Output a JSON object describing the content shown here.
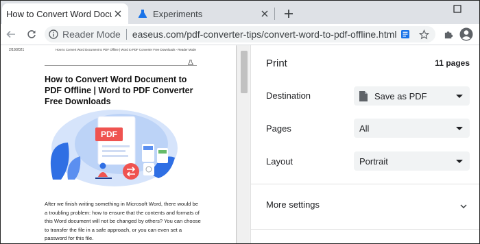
{
  "tabs": [
    {
      "title": "How to Convert Word Document",
      "active": true
    },
    {
      "title": "Experiments",
      "active": false
    }
  ],
  "omnibox": {
    "mode": "Reader Mode",
    "url": "easeus.com/pdf-converter-tips/convert-word-to-pdf-offline.html"
  },
  "preview": {
    "date": "2/19/2021",
    "header": "How to Convert Word Document to PDF Offline | Word to PDF Converter Free Downloads - Reader Mode",
    "title": "How to Convert Word Document to PDF Offline | Word to PDF Converter Free Downloads",
    "illustration_label": "PDF",
    "body": "After we finish writing something in Microsoft Word, there would be a troubling problem: how to ensure that the contents and formats of this Word document will not be changed by others? You can choose to transfer the file in a safe approach, or you can even set a password for this file."
  },
  "print": {
    "title": "Print",
    "pages_count": "11 pages",
    "destination_label": "Destination",
    "destination_value": "Save as PDF",
    "pages_label": "Pages",
    "pages_value": "All",
    "layout_label": "Layout",
    "layout_value": "Portrait",
    "more_settings": "More settings"
  },
  "colors": {
    "tabstrip": "#dee1e6",
    "omnibox": "#f1f3f4",
    "accent_blue": "#1a73e8",
    "pdf_red": "#ef5350"
  }
}
